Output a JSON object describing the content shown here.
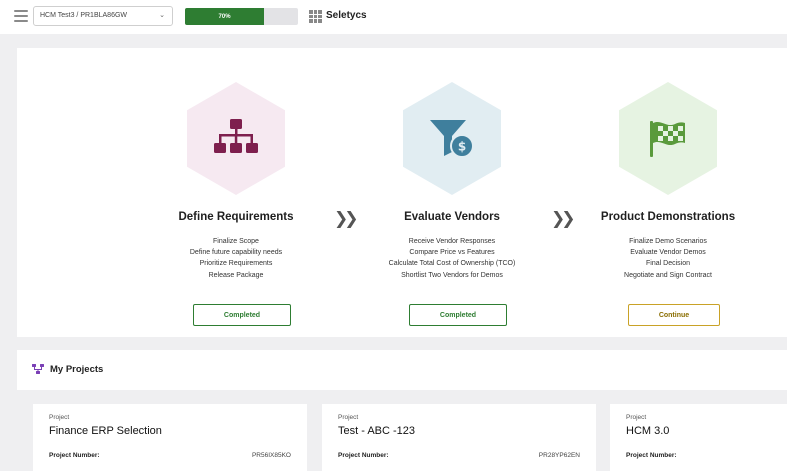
{
  "topbar": {
    "project_select": "HCM Test3 / PR1BLA86GW",
    "progress_label": "70%",
    "progress_value": 70,
    "brand": "Seletycs"
  },
  "steps": [
    {
      "title": "Define Requirements",
      "icon": "sitemap-icon",
      "hex_color": "#f6e9f1",
      "icon_color": "#7e1f4e",
      "lines": [
        "Finalize Scope",
        "Define future capability needs",
        "Prioritize Requirements",
        "Release Package"
      ],
      "button": "Completed"
    },
    {
      "title": "Evaluate Vendors",
      "icon": "funnel-dollar-icon",
      "hex_color": "#e1edf2",
      "icon_color": "#3f7f9d",
      "lines": [
        "Receive Vendor Responses",
        "Compare Price vs Features",
        "Calculate Total Cost of Ownership (TCO)",
        "Shortlist Two Vendors for Demos"
      ],
      "button": "Completed"
    },
    {
      "title": "Product Demonstrations",
      "icon": "checkered-flag-icon",
      "hex_color": "#e6f3e2",
      "icon_color": "#5a9a3c",
      "lines": [
        "Finalize Demo Scenarios",
        "Evaluate Vendor Demos",
        "Final Decision",
        "Negotiate and Sign Contract"
      ],
      "button": "Continue"
    }
  ],
  "projects_section": {
    "title": "My Projects",
    "icon": "project-tree-icon"
  },
  "projects": [
    {
      "kind": "Project",
      "name": "Finance ERP Selection",
      "number_label": "Project Number:",
      "number": "PR56IX85KO"
    },
    {
      "kind": "Project",
      "name": "Test - ABC -123",
      "number_label": "Project Number:",
      "number": "PR28YP62EN"
    },
    {
      "kind": "Project",
      "name": "HCM 3.0",
      "number_label": "Project Number:",
      "number": ""
    }
  ],
  "colors": {
    "completed": "#2e7d32",
    "continue": "#c9a227",
    "progress": "#2e7d32"
  }
}
